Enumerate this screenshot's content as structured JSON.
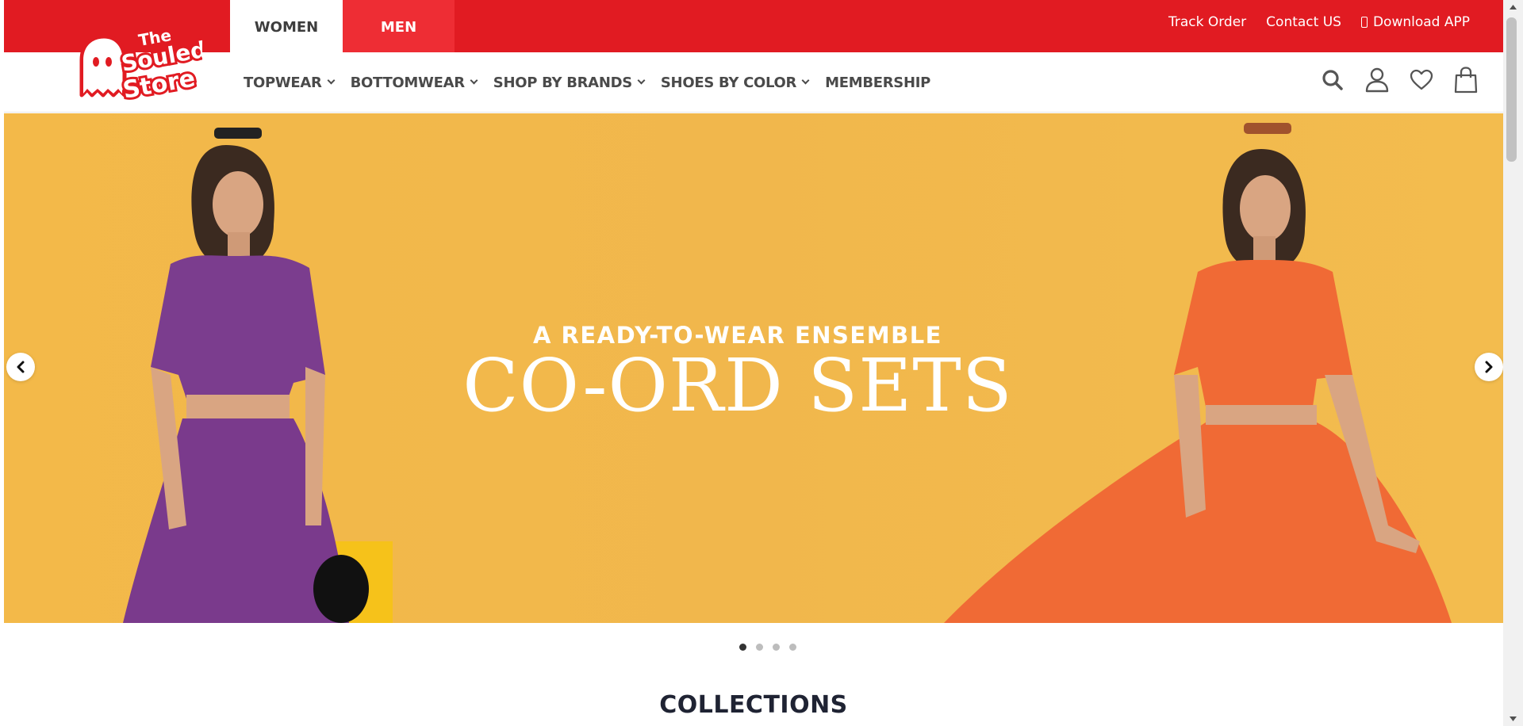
{
  "gender_tabs": {
    "women": "WOMEN",
    "men": "MEN"
  },
  "utility": {
    "track_order": "Track Order",
    "contact_us": "Contact US",
    "download_app": "Download APP"
  },
  "logo": {
    "text_line1": "The",
    "text_line2": "Souled",
    "text_line3": "Store"
  },
  "nav": {
    "items": [
      {
        "label": "TOPWEAR"
      },
      {
        "label": "BOTTOMWEAR"
      },
      {
        "label": "SHOP BY BRANDS"
      },
      {
        "label": "SHOES BY COLOR"
      },
      {
        "label": "MEMBERSHIP"
      }
    ]
  },
  "header_icons": [
    "search-icon",
    "user-icon",
    "heart-icon",
    "bag-icon"
  ],
  "hero": {
    "subtitle": "A READY-TO-WEAR ENSEMBLE",
    "title": "CO-ORD SETS",
    "background": "#f2b94b",
    "slides": 4,
    "active_slide": 1
  },
  "collections": {
    "title": "COLLECTIONS"
  },
  "colors": {
    "brand_red": "#e11b22",
    "men_tab": "#ee2d34",
    "purple": "#7b3d8e",
    "orange": "#f06a35"
  }
}
